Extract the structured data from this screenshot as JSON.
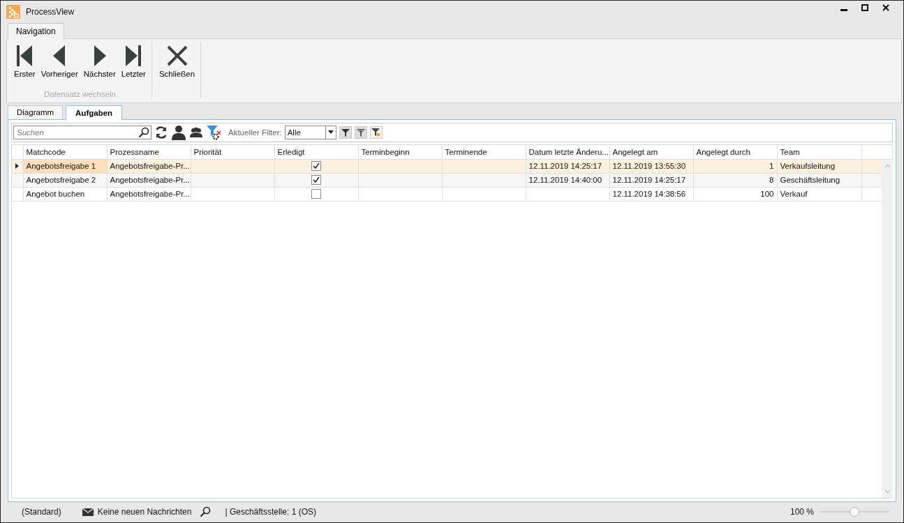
{
  "window": {
    "title": "ProcessView"
  },
  "ribbon": {
    "tabs": [
      {
        "label": "Navigation",
        "selected": true
      }
    ],
    "groups": [
      {
        "label": "Datensatz wechseln",
        "buttons": [
          {
            "kind": "first",
            "label": "Erster"
          },
          {
            "kind": "prev",
            "label": "Vorheriger"
          },
          {
            "kind": "next",
            "label": "Nächster"
          },
          {
            "kind": "last",
            "label": "Letzter"
          }
        ]
      },
      {
        "buttons": [
          {
            "kind": "close",
            "label": "Schließen"
          }
        ]
      }
    ]
  },
  "doc_tabs": [
    {
      "label": "Diagramm",
      "selected": false
    },
    {
      "label": "Aufgaben",
      "selected": true
    }
  ],
  "toolbar": {
    "search": {
      "placeholder": "Suchen"
    },
    "filter_label": "Aktueller Filter:",
    "filter_value": "Alle"
  },
  "table": {
    "columns": [
      {
        "label": "Matchcode",
        "kind": "text"
      },
      {
        "label": "Prozessname",
        "kind": "text"
      },
      {
        "label": "Priorität",
        "kind": "text"
      },
      {
        "label": "Erledigt",
        "kind": "check"
      },
      {
        "label": "Terminbeginn",
        "kind": "text"
      },
      {
        "label": "Terminende",
        "kind": "text"
      },
      {
        "label": "Datum letzte Änderu...",
        "kind": "text"
      },
      {
        "label": "Angelegt am",
        "kind": "text"
      },
      {
        "label": "Angelegt durch",
        "kind": "number"
      },
      {
        "label": "Team",
        "kind": "text"
      }
    ],
    "rows": [
      {
        "selected": true,
        "cells": [
          "Angebotsfreigabe 1",
          "Angebotsfreigabe-Pr...",
          "",
          true,
          "",
          "",
          "12.11.2019 14:25:17",
          "12.11.2019 13:55:30",
          "1",
          "Verkaufsleitung"
        ]
      },
      {
        "selected": false,
        "cells": [
          "Angebotsfreigabe 2",
          "Angebotsfreigabe-Pr...",
          "",
          true,
          "",
          "",
          "12.11.2019 14:40:00",
          "12.11.2019 14:25:17",
          "8",
          "Geschäftsleitung"
        ]
      },
      {
        "selected": false,
        "cells": [
          "Angebot buchen",
          "Angebotsfreigabe-Pr...",
          "",
          false,
          "",
          "",
          "",
          "12.11.2019 14:38:56",
          "100",
          "Verkauf"
        ]
      }
    ]
  },
  "status_bar": {
    "layout": "(Standard)",
    "messages": "Keine neuen Nachrichten",
    "branch": "| Geschäftsstelle:  1 (OS)",
    "zoom": "100 %",
    "zoom_slider": {
      "level": 0.5
    }
  }
}
